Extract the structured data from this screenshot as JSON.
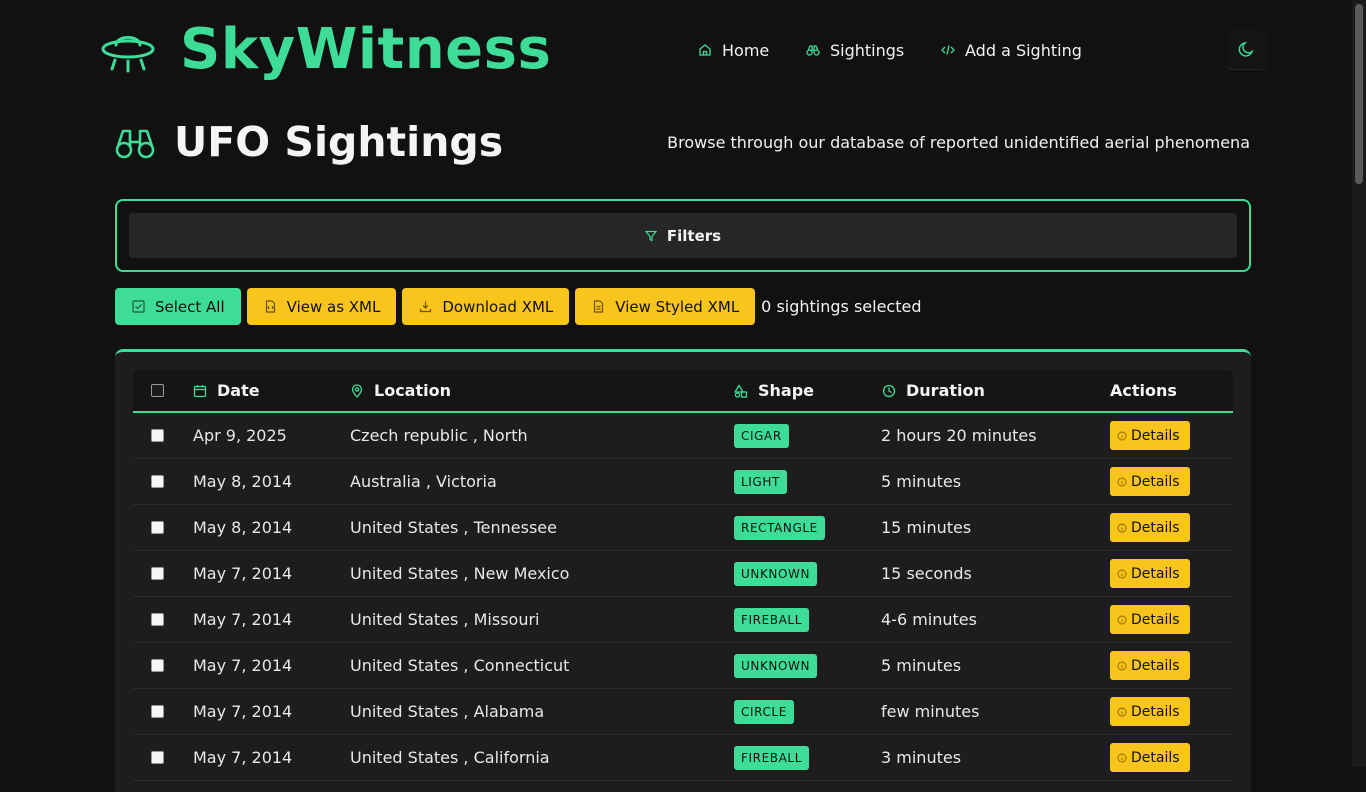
{
  "brand": {
    "name": "SkyWitness",
    "icon": "ufo-icon"
  },
  "nav": [
    {
      "label": "Home",
      "icon": "home-icon"
    },
    {
      "label": "Sightings",
      "icon": "binoculars-icon"
    },
    {
      "label": "Add a Sighting",
      "icon": "code-icon"
    }
  ],
  "theme_toggle": {
    "icon": "moon-icon"
  },
  "page": {
    "title": "UFO Sightings",
    "title_icon": "binoculars-icon",
    "subtitle": "Browse through our database of reported unidentified aerial phenomena"
  },
  "filters": {
    "label": "Filters",
    "icon": "filter-icon"
  },
  "toolbar": {
    "select_all": "Select All",
    "view_xml": "View as XML",
    "download_xml": "Download XML",
    "view_styled_xml": "View Styled XML",
    "selected_count": "0 sightings selected"
  },
  "colors": {
    "accent": "#3ddc97",
    "button_yellow": "#f9c51c",
    "background": "#111111"
  },
  "table": {
    "headers": {
      "date": "Date",
      "location": "Location",
      "shape": "Shape",
      "duration": "Duration",
      "actions": "Actions"
    },
    "details_label": "Details",
    "rows": [
      {
        "date": "Apr 9, 2025",
        "location": "Czech republic , North",
        "shape": "CIGAR",
        "duration": "2 hours 20 minutes"
      },
      {
        "date": "May 8, 2014",
        "location": "Australia , Victoria",
        "shape": "LIGHT",
        "duration": "5 minutes"
      },
      {
        "date": "May 8, 2014",
        "location": "United States , Tennessee",
        "shape": "RECTANGLE",
        "duration": "15 minutes"
      },
      {
        "date": "May 7, 2014",
        "location": "United States , New Mexico",
        "shape": "UNKNOWN",
        "duration": "15 seconds"
      },
      {
        "date": "May 7, 2014",
        "location": "United States , Missouri",
        "shape": "FIREBALL",
        "duration": "4-6 minutes"
      },
      {
        "date": "May 7, 2014",
        "location": "United States , Connecticut",
        "shape": "UNKNOWN",
        "duration": "5 minutes"
      },
      {
        "date": "May 7, 2014",
        "location": "United States , Alabama",
        "shape": "CIRCLE",
        "duration": "few minutes"
      },
      {
        "date": "May 7, 2014",
        "location": "United States , California",
        "shape": "FIREBALL",
        "duration": "3 minutes"
      }
    ]
  }
}
